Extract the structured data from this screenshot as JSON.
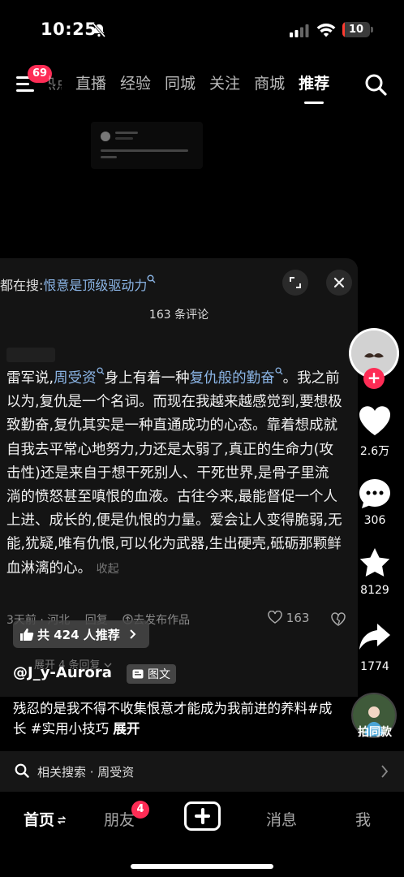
{
  "status_bar": {
    "time": "10:25",
    "battery_level": "10"
  },
  "top_nav": {
    "menu_badge": "69",
    "tabs": [
      {
        "label": "热点",
        "active": false
      },
      {
        "label": "直播",
        "active": false
      },
      {
        "label": "经验",
        "active": false
      },
      {
        "label": "同城",
        "active": false
      },
      {
        "label": "关注",
        "active": false
      },
      {
        "label": "商城",
        "active": false
      },
      {
        "label": "推荐",
        "active": true
      }
    ]
  },
  "comment_panel": {
    "hot_search_prefix": "都在搜:",
    "hot_search_keyword": "恨意是顶级驱动力",
    "title": "163 条评论",
    "comment": {
      "part1": "雷军说,",
      "link1": "周受资",
      "part2": "身上有着一种",
      "link2": "复仇般的勤奋",
      "part3": "。我之前以为,复仇是一个名词。而现在我越来越感觉到,要想极致勤奋,复仇其实是一种直通成功的心态。靠着想成就自我去平常心地努力,力还是太弱了,真正的生命力(攻击性)还是来自于想干死别人、干死世界,是骨子里流淌的愤怒甚至嗔恨的血液。古往今来,最能督促一个人上进、成长的,便是仇恨的力量。爱会让人变得脆弱,无能,犹疑,唯有仇恨,可以化为武器,生出硬壳,砥砺那颗鲜血淋漓的心。",
      "collapse": "收起",
      "time_location": "3天前 · 河北",
      "reply": "回复",
      "go_post": "去发布作品",
      "likes": "163"
    },
    "expand_replies": "展开 4 条回复"
  },
  "video": {
    "recommend_count": "共 424 人推荐",
    "author": "@J_y-Aurora",
    "type_label": "图文",
    "caption": "残忍的是我不得不收集恨意才能成为我前进的养料#成长 #实用小技巧",
    "caption_more": "展开"
  },
  "actions": {
    "likes": "2.6万",
    "comments": "306",
    "favorites": "8129",
    "shares": "1774",
    "remix_label": "拍同款"
  },
  "related_search": "相关搜索 · 周受资",
  "bottom_tabs": {
    "home": "首页",
    "friends": "朋友",
    "friends_badge": "4",
    "messages": "消息",
    "me": "我"
  }
}
